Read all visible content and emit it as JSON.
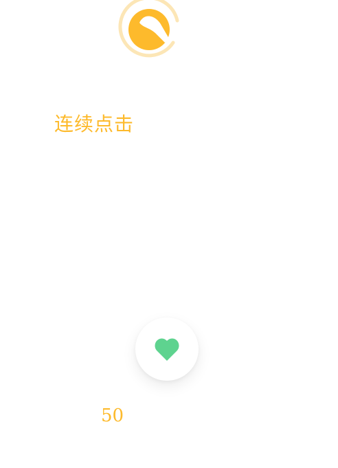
{
  "logo": {
    "icon": "app-logo-icon",
    "primary_color": "#FDBA2C",
    "ring_color": "#FCE6B6"
  },
  "title": {
    "text": "连续点击",
    "color": "#FDBA2C"
  },
  "tap_button": {
    "icon": "heart-icon",
    "icon_color": "#5ED38F"
  },
  "counter": {
    "value": "50",
    "color": "#FDBA2C"
  }
}
